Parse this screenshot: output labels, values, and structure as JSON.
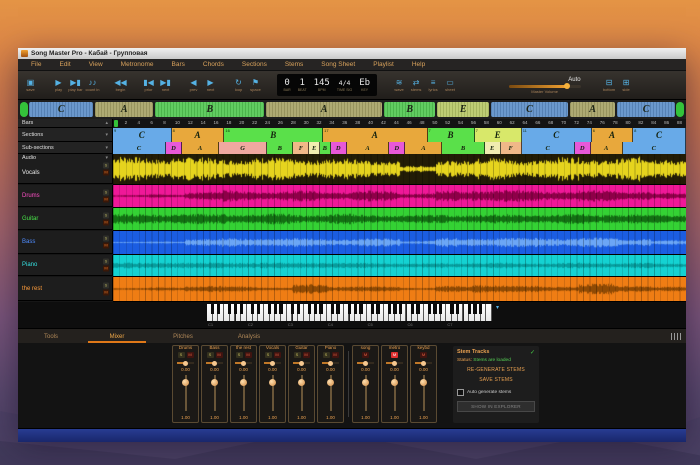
{
  "window": {
    "title": "Song Master Pro - Кабай - Групповая",
    "menu_items": [
      "File",
      "Edit",
      "View",
      "Metronome",
      "Bars",
      "Chords",
      "Sections",
      "Stems",
      "Song Sheet",
      "Playlist",
      "Help"
    ]
  },
  "toolbar": {
    "groups": [
      {
        "buttons": [
          {
            "icon": "save",
            "label": "save"
          }
        ]
      },
      {
        "buttons": [
          {
            "icon": "play",
            "label": "play"
          },
          {
            "icon": "play-bar",
            "label": "play bar"
          },
          {
            "icon": "count-in",
            "label": "count in"
          }
        ]
      },
      {
        "buttons": [
          {
            "icon": "begin",
            "label": "begin"
          }
        ]
      },
      {
        "buttons": [
          {
            "icon": "prior",
            "label": "prior"
          },
          {
            "icon": "next-section",
            "label": "next"
          }
        ]
      },
      {
        "buttons": [
          {
            "icon": "prev",
            "label": "prev"
          },
          {
            "icon": "next-bar",
            "label": "next"
          }
        ]
      },
      {
        "buttons": [
          {
            "icon": "loop",
            "label": "loop"
          },
          {
            "icon": "space",
            "label": "space"
          }
        ]
      }
    ],
    "display_cells": [
      {
        "value": "0",
        "label": "BAR",
        "small": false
      },
      {
        "value": "1",
        "label": "BEAT",
        "small": false
      },
      {
        "value": "145",
        "label": "BPM",
        "small": false
      },
      {
        "value": "4/4",
        "label": "TIME SIG",
        "small": true
      },
      {
        "value": "Eb",
        "label": "KEY",
        "small": false
      }
    ],
    "toggles": [
      {
        "icon": "wave",
        "label": "wave"
      },
      {
        "icon": "stems",
        "label": "stems"
      },
      {
        "icon": "lyrics",
        "label": "lyrics"
      },
      {
        "icon": "sheet",
        "label": "sheet"
      }
    ],
    "auto_label": "Auto",
    "master_volume_label": "Master Volume",
    "dock_buttons": [
      {
        "icon": "bottom",
        "label": "bottom"
      },
      {
        "icon": "side",
        "label": "side"
      }
    ]
  },
  "timeline": {
    "row_labels": {
      "bars": "Bars",
      "sections": "Sections",
      "subsections": "Sub-sections",
      "audio": "Audio"
    },
    "total_bars": 89,
    "ruler_step": 2,
    "ruler_max": 88,
    "sections": [
      {
        "label": "C",
        "bars": 9,
        "num": "9",
        "color": "#68aae8",
        "ov": "#6090c8"
      },
      {
        "label": "A",
        "bars": 8,
        "num": "8",
        "color": "#e8a83c",
        "ov": "#a8a468"
      },
      {
        "label": "B",
        "bars": 16,
        "num": "16",
        "color": "#5ae04a",
        "ov": "#55c855"
      },
      {
        "label": "A",
        "bars": 17,
        "num": "17",
        "color": "#e8a83c",
        "ov": "#a8a468"
      },
      {
        "label": "B",
        "bars": 7,
        "num": "7",
        "color": "#5ae04a",
        "ov": "#55c855"
      },
      {
        "label": "E",
        "bars": 7,
        "num": "7",
        "color": "#d8e86a",
        "ov": "#b8c86a"
      },
      {
        "label": "C",
        "bars": 11,
        "num": "11",
        "color": "#68aae8",
        "ov": "#6090c8"
      },
      {
        "label": "A",
        "bars": 6,
        "num": "6",
        "color": "#e8a83c",
        "ov": "#a8a468"
      },
      {
        "label": "C",
        "bars": 8,
        "num": "8",
        "color": "#68aae8",
        "ov": "#6090c8"
      }
    ],
    "subsections": [
      {
        "label": "C",
        "bars": 9,
        "color": "#68aae8"
      },
      {
        "label": "D",
        "bars": 2,
        "color": "#e858d8"
      },
      {
        "label": "A",
        "bars": 6,
        "color": "#e8a83c"
      },
      {
        "label": "G",
        "bars": 8,
        "color": "#f0a8a0"
      },
      {
        "label": "B",
        "bars": 4,
        "color": "#5ae04a"
      },
      {
        "label": "F",
        "bars": 2,
        "color": "#f0b888"
      },
      {
        "label": "E",
        "bars": 1,
        "color": "#f0ecb0"
      },
      {
        "label": "B",
        "bars": 1,
        "color": "#5ae04a"
      },
      {
        "label": "D",
        "bars": 2,
        "color": "#e858d8"
      },
      {
        "label": "A",
        "bars": 7,
        "color": "#e8a83c"
      },
      {
        "label": "D",
        "bars": 2,
        "color": "#e858d8"
      },
      {
        "label": "A",
        "bars": 6,
        "color": "#e8a83c"
      },
      {
        "label": "B",
        "bars": 7,
        "color": "#5ae04a"
      },
      {
        "label": "E",
        "bars": 2,
        "color": "#f0ecb0"
      },
      {
        "label": "F",
        "bars": 3,
        "color": "#f0b888"
      },
      {
        "label": "C",
        "bars": 9,
        "color": "#68aae8"
      },
      {
        "label": "D",
        "bars": 2,
        "color": "#e858d8"
      },
      {
        "label": "A",
        "bars": 5,
        "color": "#e8a83c"
      },
      {
        "label": "C",
        "bars": 11,
        "color": "#68aae8"
      }
    ],
    "solo_label": "S",
    "mute_label": "M",
    "tracks": [
      {
        "name": "Vocals",
        "label_color": "#e8e8e8",
        "bg": "#221c06",
        "wave": "#e6d41e",
        "height": 30,
        "seed": 7,
        "envelope": [
          0.9,
          0.92,
          0.85,
          0.9,
          0.88,
          0.9,
          0.86,
          0.82,
          0.25,
          0.9,
          0.92,
          0.86,
          0.9,
          0.84,
          0.88,
          0.8
        ]
      },
      {
        "name": "Drums",
        "label_color": "#ff4fc6",
        "bg": "#ef1898",
        "wave": "#8e0048",
        "height": 22,
        "seed": 11,
        "envelope": [
          0.12,
          0.18,
          0.5,
          0.62,
          0.55,
          0.6,
          0.52,
          0.56,
          0.3,
          0.52,
          0.62,
          0.55,
          0.5,
          0.56,
          0.5,
          0.3
        ]
      },
      {
        "name": "Guitar",
        "label_color": "#49e549",
        "bg": "#34d234",
        "wave": "#137013",
        "height": 22,
        "seed": 13,
        "envelope": [
          0.5,
          0.55,
          0.5,
          0.6,
          0.55,
          0.5,
          0.55,
          0.5,
          0.45,
          0.55,
          0.5,
          0.55,
          0.5,
          0.55,
          0.5,
          0.45
        ]
      },
      {
        "name": "Bass",
        "label_color": "#4f8cff",
        "bg": "#1b5de2",
        "wave": "#6ca6f5",
        "height": 23,
        "seed": 17,
        "envelope": [
          0.08,
          0.1,
          0.42,
          0.46,
          0.5,
          0.46,
          0.42,
          0.46,
          0.2,
          0.46,
          0.5,
          0.46,
          0.42,
          0.46,
          0.42,
          0.2
        ]
      },
      {
        "name": "Piano",
        "label_color": "#35e2e2",
        "bg": "#14d2d2",
        "wave": "#079c9c",
        "height": 21,
        "seed": 19,
        "envelope": [
          0.3,
          0.34,
          0.3,
          0.34,
          0.3,
          0.34,
          0.3,
          0.3,
          0.24,
          0.3,
          0.34,
          0.3,
          0.3,
          0.34,
          0.3,
          0.24
        ]
      },
      {
        "name": "the rest",
        "label_color": "#ff9d3b",
        "bg": "#ef7d14",
        "wave": "#8f4a04",
        "height": 24,
        "seed": 23,
        "envelope": [
          0.1,
          0.15,
          0.32,
          0.26,
          0.2,
          0.5,
          0.3,
          0.26,
          0.15,
          0.3,
          0.46,
          0.3,
          0.26,
          0.5,
          0.34,
          0.2
        ]
      }
    ]
  },
  "keyboard": {
    "octave_labels": [
      "C1",
      "C2",
      "C3",
      "C4",
      "C5",
      "C6",
      "C7"
    ]
  },
  "tabs": {
    "items": [
      "Tools",
      "Mixer",
      "Pitches",
      "Analysis"
    ],
    "active": "Mixer"
  },
  "mixer": {
    "pan_value": "0.00",
    "vol_value": "1.00",
    "channels": [
      {
        "name": "Drums"
      },
      {
        "name": "Bass"
      },
      {
        "name": "the rest"
      },
      {
        "name": "Vocals"
      },
      {
        "name": "Guitar"
      },
      {
        "name": "Piano"
      }
    ],
    "aux_channels": [
      {
        "name": "song",
        "muted": false
      },
      {
        "name": "metro",
        "muted": true
      },
      {
        "name": "keybd",
        "muted": false
      }
    ]
  },
  "stem_panel": {
    "title": "Stem Tracks",
    "check_icon": "✓",
    "status_label": "Status:",
    "status_value": "Stems are loaded",
    "regenerate_button": "RE-GENERATE STEMS",
    "save_button": "SAVE STEMS",
    "auto_checkbox_label": "Auto generate stems",
    "explorer_button": "SHOW IN EXPLORER"
  },
  "colors": {
    "accent_orange": "#e07818",
    "icon_blue": "#55b2e4",
    "status_green": "#55d055",
    "playhead_green": "#34c23a"
  }
}
